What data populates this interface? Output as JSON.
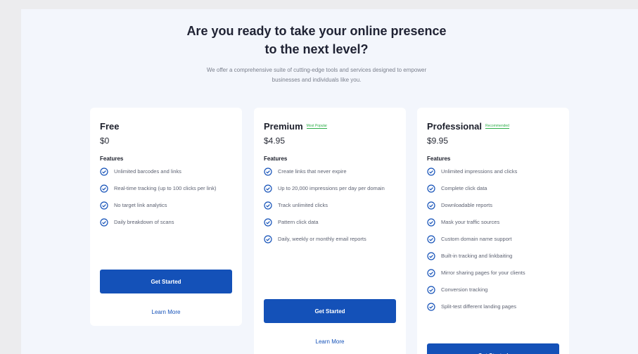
{
  "hero": {
    "title": "Are you ready to take your online presence to the next level?",
    "subtitle": "We offer a comprehensive suite of cutting-edge tools and services designed to empower businesses and individuals like you."
  },
  "colors": {
    "accent": "#1451b8",
    "tag_green": "#2fae4a",
    "panel_bg": "#f3f6fc"
  },
  "plans": [
    {
      "name": "Free",
      "tag": "",
      "price": "$0",
      "features_label": "Features",
      "features": [
        "Unlimited barcodes and links",
        "Real-time tracking (up to 100 clicks per link)",
        "No target link analytics",
        "Daily breakdown of scans"
      ],
      "cta": "Get Started",
      "learn_more": "Learn More"
    },
    {
      "name": "Premium",
      "tag": "Most Popular",
      "price": "$4.95",
      "features_label": "Features",
      "features": [
        "Create links that never expire",
        "Up to 20,000 impressions per day per domain",
        "Track unlimited clicks",
        "Pattern click data",
        "Daily, weekly or monthly email reports"
      ],
      "cta": "Get Started",
      "learn_more": "Learn More"
    },
    {
      "name": "Professional",
      "tag": "Recommended",
      "price": "$9.95",
      "features_label": "Features",
      "features": [
        "Unlimited impressions and clicks",
        "Complete click data",
        "Downloadable reports",
        "Mask your traffic sources",
        "Custom domain name support",
        "Built-in tracking and linkbaiting",
        "Mirror sharing pages for your clients",
        "Conversion tracking",
        "Split-test different landing pages"
      ],
      "cta": "Get Started"
    }
  ]
}
